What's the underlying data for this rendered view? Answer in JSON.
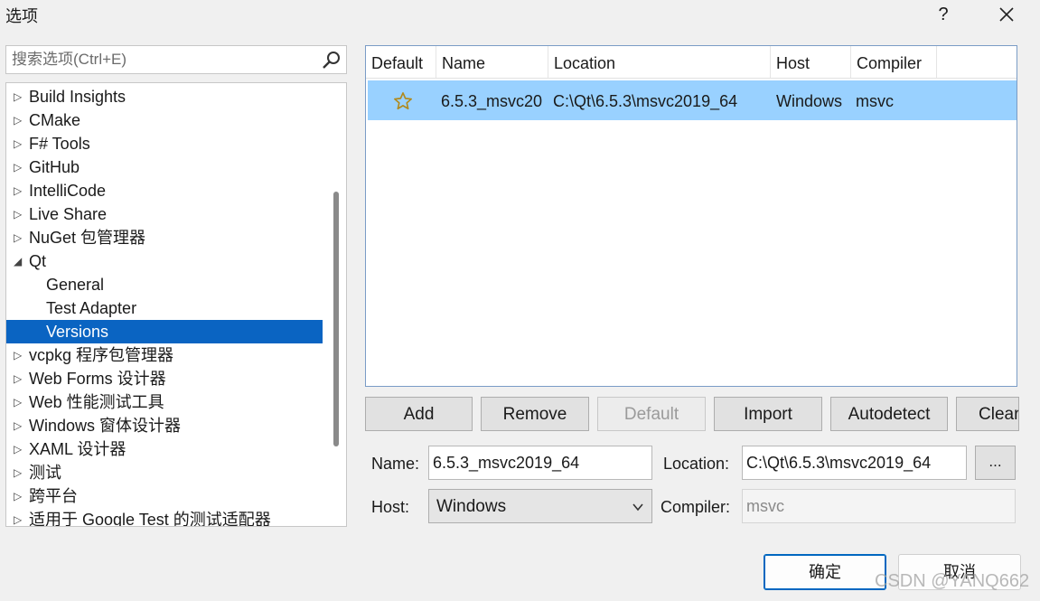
{
  "window": {
    "title": "选项",
    "help_label": "?"
  },
  "search": {
    "placeholder": "搜索选项(Ctrl+E)"
  },
  "tree": {
    "items": [
      {
        "label": "Build Insights",
        "arrow": "▷"
      },
      {
        "label": "CMake",
        "arrow": "▷"
      },
      {
        "label": "F# Tools",
        "arrow": "▷"
      },
      {
        "label": "GitHub",
        "arrow": "▷"
      },
      {
        "label": "IntelliCode",
        "arrow": "▷"
      },
      {
        "label": "Live Share",
        "arrow": "▷"
      },
      {
        "label": "NuGet 包管理器",
        "arrow": "▷"
      },
      {
        "label": "Qt",
        "arrow": "◢"
      },
      {
        "label": "General",
        "arrow": ""
      },
      {
        "label": "Test Adapter",
        "arrow": ""
      },
      {
        "label": "Versions",
        "arrow": "",
        "selected": true
      },
      {
        "label": "vcpkg 程序包管理器",
        "arrow": "▷"
      },
      {
        "label": "Web Forms 设计器",
        "arrow": "▷"
      },
      {
        "label": "Web 性能测试工具",
        "arrow": "▷"
      },
      {
        "label": "Windows 窗体设计器",
        "arrow": "▷"
      },
      {
        "label": "XAML 设计器",
        "arrow": "▷"
      },
      {
        "label": "测试",
        "arrow": "▷"
      },
      {
        "label": "跨平台",
        "arrow": "▷"
      },
      {
        "label": "适用于 Google Test 的测试适配器",
        "arrow": "▷"
      }
    ]
  },
  "versions_table": {
    "headers": [
      "Default",
      "Name",
      "Location",
      "Host",
      "Compiler"
    ],
    "rows": [
      {
        "default_icon": "star-icon",
        "name": "6.5.3_msvc20",
        "location": "C:\\Qt\\6.5.3\\msvc2019_64",
        "host": "Windows",
        "compiler": "msvc"
      }
    ]
  },
  "actions": {
    "add": "Add",
    "remove": "Remove",
    "default": "Default",
    "import": "Import",
    "autodetect": "Autodetect",
    "clear": "Clear"
  },
  "form": {
    "name_label": "Name:",
    "name_value": "6.5.3_msvc2019_64",
    "location_label": "Location:",
    "location_value": "C:\\Qt\\6.5.3\\msvc2019_64",
    "browse_label": "...",
    "host_label": "Host:",
    "host_value": "Windows",
    "compiler_label": "Compiler:",
    "compiler_value": "msvc"
  },
  "dialog": {
    "ok": "确定",
    "cancel": "取消"
  },
  "watermark": "CSDN @YANQ662",
  "colors": {
    "selection": "#0a64c2",
    "row_highlight": "#99d1ff",
    "star": "#b08a1e"
  }
}
